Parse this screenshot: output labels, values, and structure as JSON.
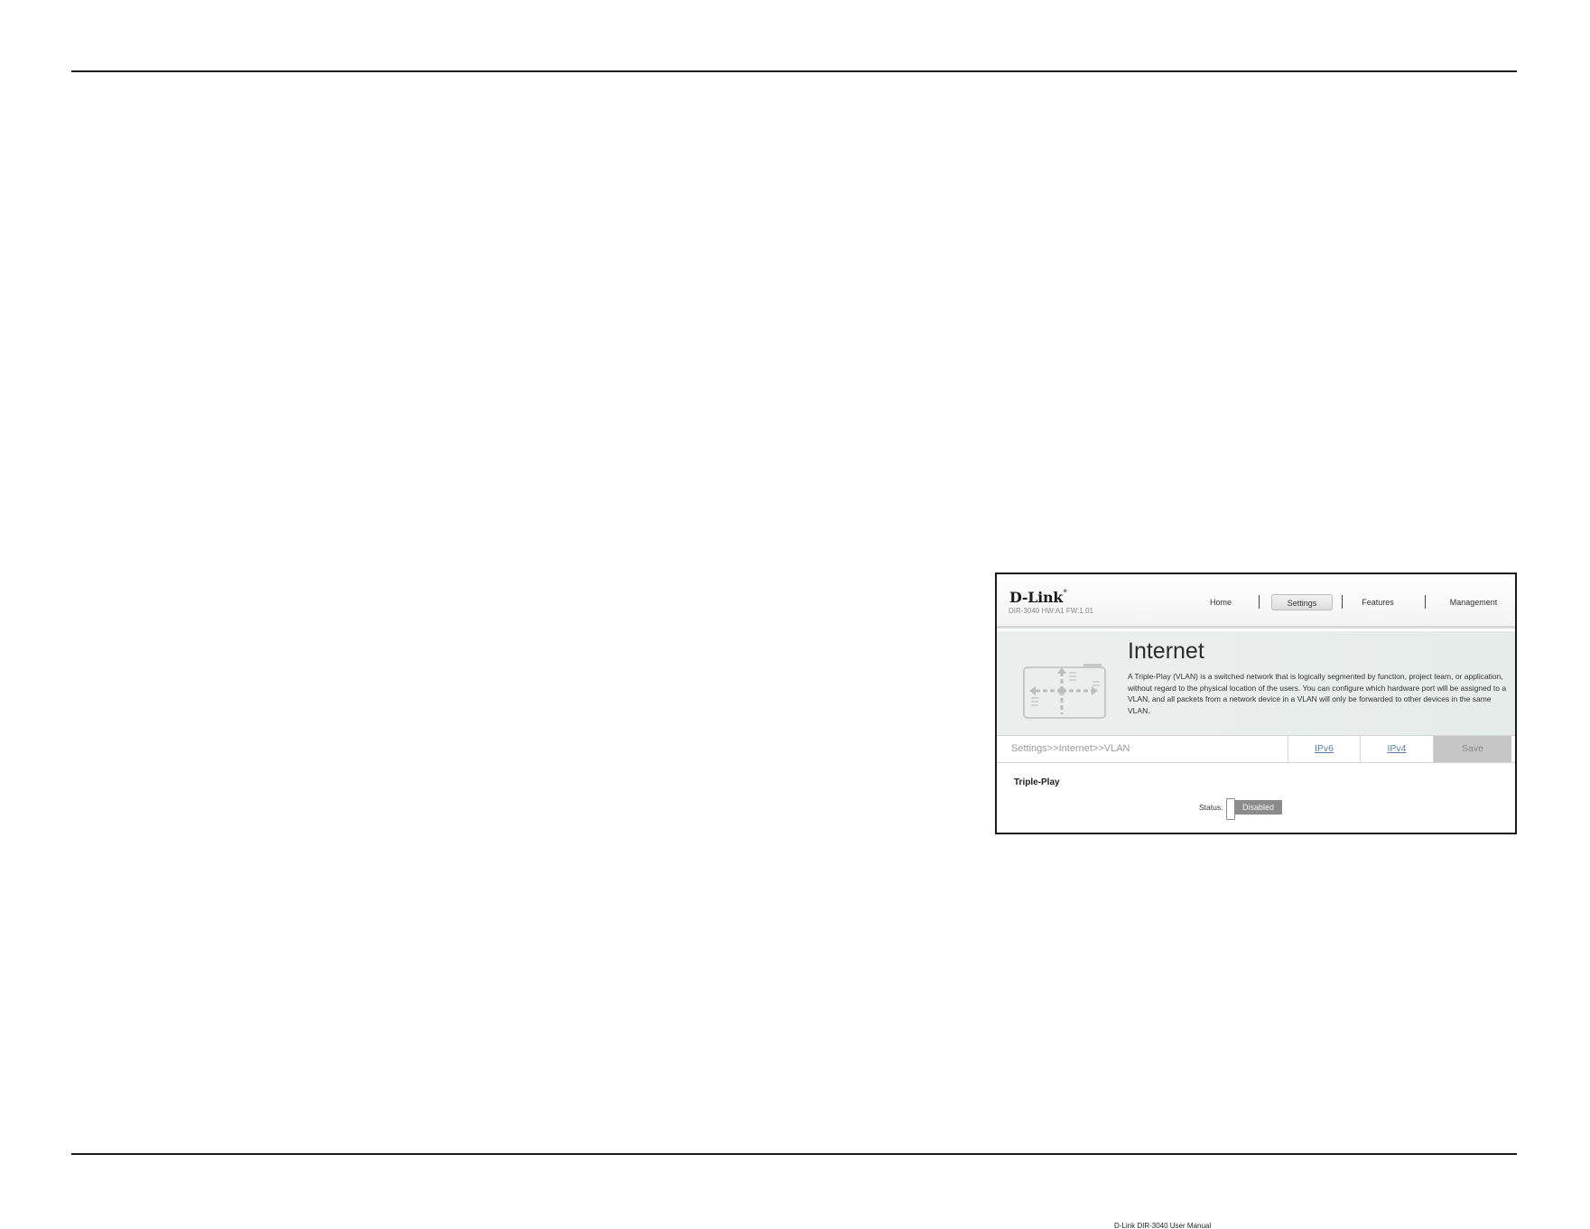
{
  "screenshot": {
    "logo": "D-Link",
    "logo_mark": "®",
    "model_info": "DIR-3040 HW:A1 FW:1.01",
    "nav": {
      "home": "Home",
      "settings": "Settings",
      "features": "Features",
      "management": "Management"
    },
    "banner": {
      "title": "Internet",
      "description": "A Triple-Play (VLAN) is a switched network that is logically segmented by function, project team, or application, without regard to the physical location of the users. You can configure which hardware port will be assigned to a VLAN, and all packets from a network device in a VLAN will only be forwarded to other devices in the same VLAN."
    },
    "breadcrumb": "Settings>>Internet>>VLAN",
    "tabs": {
      "ipv6": "IPv6",
      "ipv4": "IPv4",
      "save": "Save"
    },
    "section": {
      "title": "Triple-Play",
      "status_label": "Status:",
      "status_value": "Disabled"
    }
  },
  "footer": {
    "text": "D-Link DIR-3040 User Manual"
  },
  "colors": {
    "rule": "#1c1c1c",
    "link": "#5a7fa8",
    "save_bg": "#c6c6c6",
    "toggle_bg": "#8b8b8b",
    "banner_bg": "#eceeed"
  }
}
